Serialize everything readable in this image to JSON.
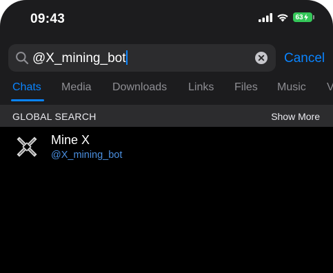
{
  "status_bar": {
    "time": "09:43",
    "battery": "63",
    "icons": [
      "signal-icon",
      "wifi-icon",
      "battery-charging-icon"
    ]
  },
  "search": {
    "query": "@X_mining_bot",
    "cancel_label": "Cancel",
    "icons": [
      "search-icon",
      "clear-icon"
    ]
  },
  "tabs": {
    "items": [
      "Chats",
      "Media",
      "Downloads",
      "Links",
      "Files",
      "Music",
      "V"
    ],
    "active": "Chats"
  },
  "section": {
    "title": "GLOBAL SEARCH",
    "action": "Show More"
  },
  "results": [
    {
      "name": "Mine X",
      "handle": "@X_mining_bot",
      "avatar_icon": "mine-x-logo-icon"
    }
  ],
  "colors": {
    "accent": "#0a84ff",
    "battery_green": "#34c759",
    "background": "#000000",
    "panel": "#1c1c1e",
    "field": "#2c2c2e"
  }
}
